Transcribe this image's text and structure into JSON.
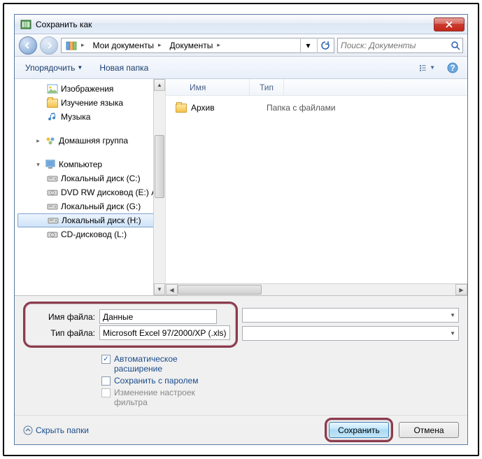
{
  "window": {
    "title": "Сохранить как"
  },
  "nav": {
    "breadcrumb": [
      "Мои документы",
      "Документы"
    ],
    "search_placeholder": "Поиск: Документы"
  },
  "toolbar": {
    "organize": "Упорядочить",
    "new_folder": "Новая папка"
  },
  "columns": {
    "name": "Имя",
    "type": "Тип"
  },
  "files": [
    {
      "name": "Архив",
      "type": "Папка с файлами"
    }
  ],
  "sidebar": {
    "items": [
      {
        "label": "Изображения",
        "level": 2,
        "icon": "picture"
      },
      {
        "label": "Изучение языка",
        "level": 2,
        "icon": "folder"
      },
      {
        "label": "Музыка",
        "level": 2,
        "icon": "music"
      },
      {
        "label": "",
        "level": 0,
        "spacer": true
      },
      {
        "label": "Домашняя группа",
        "level": 1,
        "icon": "homegroup",
        "expand": "closed"
      },
      {
        "label": "",
        "level": 0,
        "spacer": true
      },
      {
        "label": "Компьютер",
        "level": 1,
        "icon": "computer",
        "expand": "open"
      },
      {
        "label": "Локальный диск (C:)",
        "level": 2,
        "icon": "drive"
      },
      {
        "label": "DVD RW дисковод (E:) Au",
        "level": 2,
        "icon": "dvd"
      },
      {
        "label": "Локальный диск (G:)",
        "level": 2,
        "icon": "drive"
      },
      {
        "label": "Локальный диск (H:)",
        "level": 2,
        "icon": "drive",
        "selected": true
      },
      {
        "label": "CD-дисковод (L:)",
        "level": 2,
        "icon": "dvd"
      }
    ]
  },
  "form": {
    "filename_label": "Имя файла:",
    "filename_value": "Данные",
    "filetype_label": "Тип файла:",
    "filetype_value": "Microsoft Excel 97/2000/XP (.xls)",
    "cb_auto": "Автоматическое расширение",
    "cb_password": "Сохранить с паролем",
    "cb_filter": "Изменение настроек фильтра"
  },
  "footer": {
    "hide_folders": "Скрыть папки",
    "save": "Сохранить",
    "cancel": "Отмена"
  }
}
